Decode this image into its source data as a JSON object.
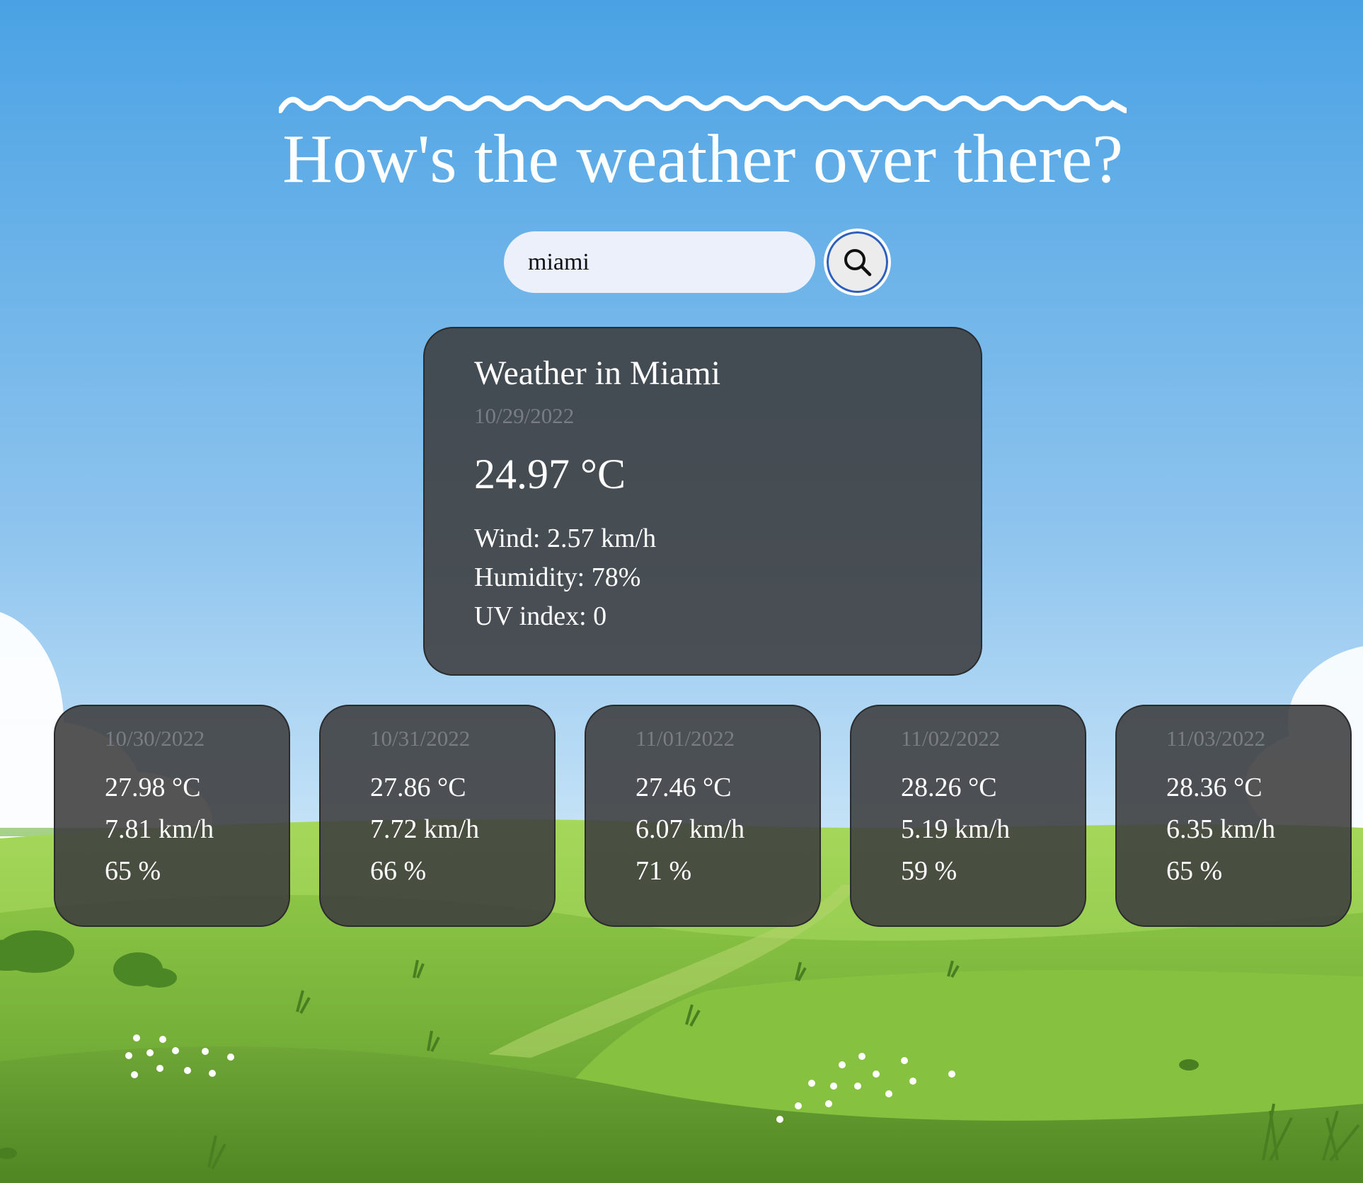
{
  "header": {
    "title": "How's the weather over there?"
  },
  "search": {
    "value": "miami",
    "button_icon": "search-icon"
  },
  "current": {
    "title": "Weather in Miami",
    "date": "10/29/2022",
    "temperature": "24.97 °C",
    "wind": "Wind: 2.57 km/h",
    "humidity": "Humidity: 78%",
    "uv": "UV index: 0"
  },
  "forecast": [
    {
      "date": "10/30/2022",
      "temp": "27.98 °C",
      "wind": "7.81 km/h",
      "humidity": "65 %"
    },
    {
      "date": "10/31/2022",
      "temp": "27.86 °C",
      "wind": "7.72 km/h",
      "humidity": "66 %"
    },
    {
      "date": "11/01/2022",
      "temp": "27.46 °C",
      "wind": "6.07 km/h",
      "humidity": "71 %"
    },
    {
      "date": "11/02/2022",
      "temp": "28.26 °C",
      "wind": "5.19 km/h",
      "humidity": "59 %"
    },
    {
      "date": "11/03/2022",
      "temp": "28.36 °C",
      "wind": "6.35 km/h",
      "humidity": "65 %"
    }
  ],
  "colors": {
    "sky_top": "#4aa2e4",
    "sky_bottom": "#bfe0f6",
    "card_bg": "#3c3c3e",
    "date_text": "#7a7d83",
    "grass": "#6aa83a",
    "search_ring": "#2d5fbf"
  }
}
